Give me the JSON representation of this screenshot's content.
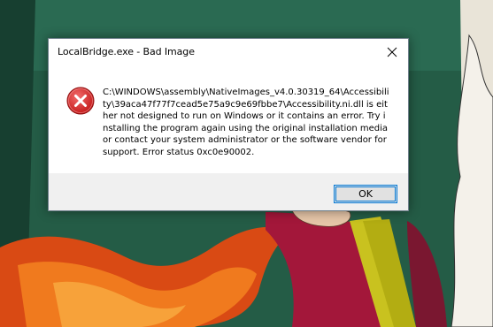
{
  "window": {
    "title": "LocalBridge.exe - Bad Image",
    "close_icon": "close-icon",
    "error_icon": "error-icon"
  },
  "message": {
    "text": "C:\\WINDOWS\\assembly\\NativeImages_v4.0.30319_64\\Accessibility\\39aca47f77f7cead5e75a9c9e69fbbe7\\Accessibility.ni.dll is either not designed to run on Windows or it contains an error. Try installing the program again using the original installation media or contact your system administrator or the software vendor for support. Error status 0xc0e90002."
  },
  "buttons": {
    "ok_label": "OK"
  },
  "colors": {
    "error_red": "#d32f2f",
    "focus_blue": "#0078d7",
    "footer_gray": "#f0f0f0"
  }
}
